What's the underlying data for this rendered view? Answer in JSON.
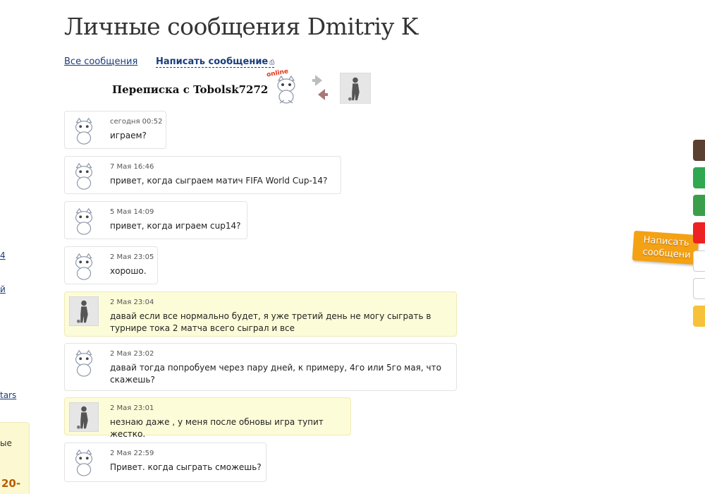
{
  "page": {
    "title": "Личные сообщения Dmitriy K"
  },
  "tabs": {
    "all_messages": "Все сообщения",
    "write_message": "Написать сообщение"
  },
  "conversation": {
    "title": "Переписка с Tobolsk7272",
    "online_label": "online"
  },
  "messages": [
    {
      "date": "сегодня 00:52",
      "text": "играем?",
      "author": "partner"
    },
    {
      "date": "7 Мая 16:46",
      "text": "привет, когда сыграем матич FIFA World Cup-14?",
      "author": "partner"
    },
    {
      "date": "5 Мая 14:09",
      "text": "привет, когда играем cup14?",
      "author": "partner"
    },
    {
      "date": "2 Мая 23:05",
      "text": "хорошо.",
      "author": "partner"
    },
    {
      "date": "2 Мая 23:04",
      "text": "давай если все нормально будет, я уже третий день не могу сыграть в турнире тока 2 матча всего сыграл и все",
      "author": "me"
    },
    {
      "date": "2 Мая 23:02",
      "text": "давай тогда попробуем через пару дней, к примеру, 4го или 5го мая, что скажешь?",
      "author": "partner"
    },
    {
      "date": "2 Мая 23:01",
      "text": "незнаю даже , у меня после обновы игра тупит жестко.",
      "author": "me"
    },
    {
      "date": "2 Мая 22:59",
      "text": "Привет. когда сыграть сможешь?",
      "author": "partner"
    }
  ],
  "left_sidebar": {
    "frag1": "4",
    "frag2": "й",
    "frag3": "tars",
    "box_text": "ые",
    "box_number": "20-"
  },
  "right_widget": {
    "write_button": "Написать сообщени"
  },
  "colors": {
    "link": "#1a3d7c",
    "my_message_bg": "#fdfcd8",
    "online": "#e2341a",
    "ribbon": "#f4a114"
  }
}
